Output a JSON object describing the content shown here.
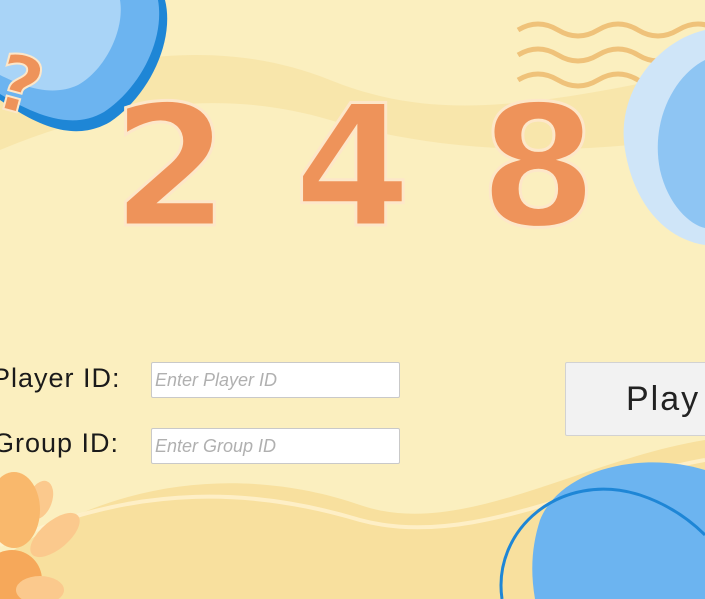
{
  "title": {
    "digits": [
      "2",
      "4",
      "8"
    ]
  },
  "form": {
    "player_label": "Player ID:",
    "player_placeholder": "Enter Player ID",
    "group_label": "Group ID:",
    "group_placeholder": "Enter Group ID"
  },
  "play_button": {
    "label": "Play"
  },
  "decoration": {
    "question_glyph": "?"
  },
  "colors": {
    "background": "#fbefbf",
    "wave": "#f7dd98",
    "digit_orange": "#ee935a",
    "blue_blob": "#6cb4f0",
    "light_blue": "#b6d9f7"
  }
}
